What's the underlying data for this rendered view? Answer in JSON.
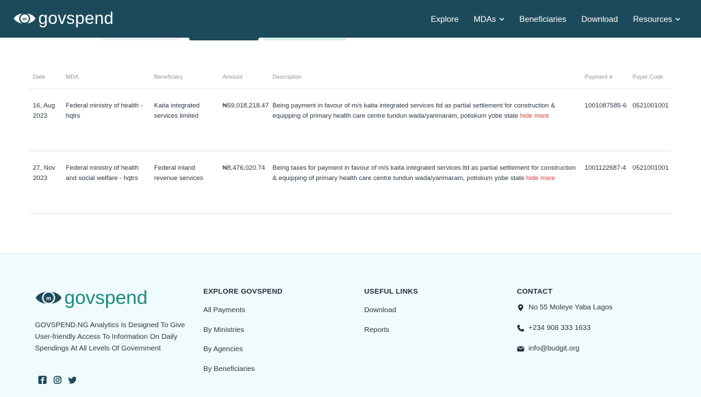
{
  "header": {
    "logo_text": "govspend",
    "nav": [
      {
        "label": "Explore",
        "dropdown": false
      },
      {
        "label": "MDAs",
        "dropdown": true
      },
      {
        "label": "Beneficiaries",
        "dropdown": false
      },
      {
        "label": "Download",
        "dropdown": false
      },
      {
        "label": "Resources",
        "dropdown": true
      }
    ]
  },
  "table": {
    "columns": [
      "Date",
      "MDA",
      "Beneficiary",
      "Amount",
      "Description",
      "Payment #",
      "Payer Code"
    ],
    "rows": [
      {
        "date": "16, Aug 2023",
        "mda": "Federal ministry of health - hqtrs",
        "beneficiary": "Kaita integrated services limited",
        "amount": "₦59,018,218.47",
        "description": "Being payment in favour of m/s kaita integrated services ltd as partial settlement for construction & equipping of primary health care centre tundun wada/yarimaram, potiskum yobe state",
        "toggle": "hide more",
        "payment_no": "1001087585-6",
        "payer_code": "0521001001"
      },
      {
        "date": "27, Nov 2023",
        "mda": "Federal ministry of health and social welfare - hqtrs",
        "beneficiary": "Federal inland revenue services",
        "amount": "₦8,476,020.74",
        "description": "Being taxes for payment in favour of m/s kaita integrated services ltd as partial settlement for construction & equipping of primary health care centre tundun wada/yarimaram, potiskum yobe state",
        "toggle": "hide more",
        "payment_no": "1001122687-4",
        "payer_code": "0521001001"
      }
    ]
  },
  "footer": {
    "logo_text": "govspend",
    "about": "GOVSPEND.NG Analytics Is Designed To Give User-friendly Access To Information On Daily Spendings At All Levels Of Government",
    "social": [
      "facebook-icon",
      "instagram-icon",
      "twitter-icon"
    ],
    "explore": {
      "title": "EXPLORE GOVSPEND",
      "links": [
        "All Payments",
        "By Ministries",
        "By Agencies",
        "By Beneficiaries"
      ]
    },
    "useful": {
      "title": "USEFUL LINKS",
      "links": [
        "Download",
        "Reports"
      ]
    },
    "contact": {
      "title": "CONTACT",
      "address": "No 55 Moleye Yaba Lagos",
      "phone": "+234 908 333 1633",
      "email": "info@budgit.org"
    }
  },
  "colors": {
    "header_bg": "#1c4a5a",
    "accent_teal": "#1c8a82",
    "link_red": "#d63b3b",
    "footer_bg": "#f0fbfd"
  }
}
